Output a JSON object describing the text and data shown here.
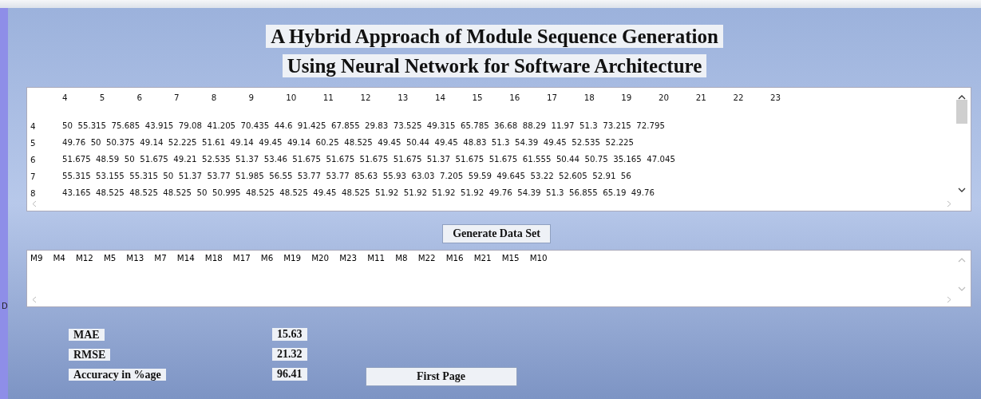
{
  "title_lines": [
    "A Hybrid Approach of Module Sequence Generation",
    "Using Neural Network for Software Architecture"
  ],
  "matrix": {
    "columns": [
      "4",
      "5",
      "6",
      "7",
      "8",
      "9",
      "10",
      "11",
      "12",
      "13",
      "14",
      "15",
      "16",
      "17",
      "18",
      "19",
      "20",
      "21",
      "22",
      "23"
    ],
    "rows": [
      {
        "label": "4",
        "values": [
          "50",
          "55.315",
          "75.685",
          "43.915",
          "79.08",
          "41.205",
          "70.435",
          "44.6",
          "91.425",
          "67.855",
          "29.83",
          "73.525",
          "49.315",
          "65.785",
          "36.68",
          "88.29",
          "11.97",
          "51.3",
          "73.215",
          "72.795"
        ]
      },
      {
        "label": "5",
        "values": [
          "49.76",
          "50",
          "50.375",
          "49.14",
          "52.225",
          "51.61",
          "49.14",
          "49.45",
          "49.14",
          "60.25",
          "48.525",
          "49.45",
          "50.44",
          "49.45",
          "48.83",
          "51.3",
          "54.39",
          "49.45",
          "52.535",
          "52.225"
        ]
      },
      {
        "label": "6",
        "values": [
          "51.675",
          "48.59",
          "50",
          "51.675",
          "49.21",
          "52.535",
          "51.37",
          "53.46",
          "51.675",
          "51.675",
          "51.675",
          "51.675",
          "51.37",
          "51.675",
          "51.675",
          "61.555",
          "50.44",
          "50.75",
          "35.165",
          "47.045"
        ]
      },
      {
        "label": "7",
        "values": [
          "55.315",
          "53.155",
          "55.315",
          "50",
          "51.37",
          "53.77",
          "51.985",
          "56.55",
          "53.77",
          "53.77",
          "85.63",
          "55.93",
          "63.03",
          "7.205",
          "59.59",
          "49.645",
          "53.22",
          "52.605",
          "52.91",
          "56"
        ]
      },
      {
        "label": "8",
        "values": [
          "43.165",
          "48.525",
          "48.525",
          "48.525",
          "50",
          "50.995",
          "48.525",
          "48.525",
          "49.45",
          "48.525",
          "51.92",
          "51.92",
          "51.92",
          "51.92",
          "49.76",
          "54.39",
          "51.3",
          "56.855",
          "65.19",
          "49.76"
        ]
      }
    ]
  },
  "side_fragment": "D",
  "generate_button": "Generate Data Set",
  "sequence": [
    "M9",
    "M4",
    "M12",
    "M5",
    "M13",
    "M7",
    "M14",
    "M18",
    "M17",
    "M6",
    "M19",
    "M20",
    "M23",
    "M11",
    "M8",
    "M22",
    "M16",
    "M21",
    "M15",
    "M10"
  ],
  "metrics": [
    {
      "label": "MAE",
      "value": "15.63"
    },
    {
      "label": "RMSE",
      "value": "21.32"
    },
    {
      "label": "Accuracy in %age",
      "value": "96.41"
    }
  ],
  "first_page_button": "First Page"
}
